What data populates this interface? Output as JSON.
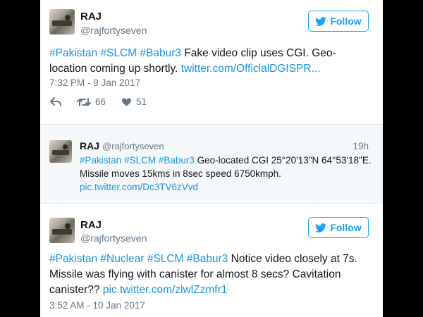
{
  "tweets": [
    {
      "name": "RAJ",
      "handle": "@rajfortyseven",
      "follow_label": "Follow",
      "hashtags": [
        "#Pakistan",
        "#SLCM",
        "#Babur3"
      ],
      "text": "Fake video clip uses CGI. Geo-location coming up shortly.",
      "link": "twitter.com/OfficialDGISPR...",
      "timestamp": "7:32 PM - 9 Jan 2017",
      "retweets": "66",
      "likes": "51"
    },
    {
      "name": "RAJ",
      "handle": "@rajfortyseven",
      "age": "19h",
      "hashtags": [
        "#Pakistan",
        "#SLCM",
        "#Babur3"
      ],
      "text": "Geo-located CGI 25°20'13\"N 64°53'18\"E. Missile moves 15kms in 8sec speed 6750kmph.",
      "link": "pic.twitter.com/Dc3TV6zVvd"
    },
    {
      "name": "RAJ",
      "handle": "@rajfortyseven",
      "follow_label": "Follow",
      "hashtags": [
        "#Pakistan",
        "#Nuclear",
        "#SLCM",
        "#Babur3"
      ],
      "text": "Notice video closely at 7s. Missile was flying with canister for almost 8 secs? Cavitation canister??",
      "link": "pic.twitter.com/zlwlZzmfr1",
      "timestamp": "3:52 AM - 10 Jan 2017"
    }
  ],
  "colors": {
    "accent": "#1da1f2",
    "link": "#1b95e0",
    "muted": "#657786",
    "text": "#14171a",
    "reply_bg": "#f5f8fa"
  },
  "icons": [
    "twitter-bird-icon",
    "reply-icon",
    "retweet-icon",
    "heart-icon"
  ]
}
